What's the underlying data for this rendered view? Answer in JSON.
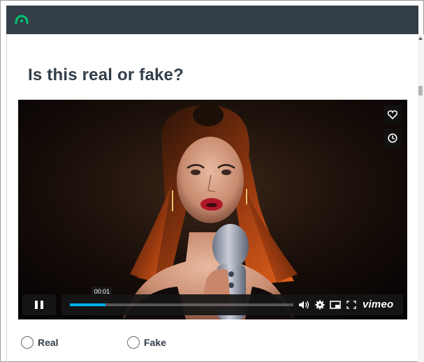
{
  "header": {
    "logo_icon": "surveymonkey-logo-icon",
    "background": "#333e48"
  },
  "question": {
    "title": "Is this real or fake?"
  },
  "video": {
    "progress_percent": 16,
    "time_tooltip": "00:01",
    "brand": "vimeo",
    "overlay_icons": [
      "heart-icon",
      "clock-icon"
    ],
    "control_icons": [
      "pause-icon",
      "volume-icon",
      "gear-icon",
      "pip-icon",
      "fullscreen-icon"
    ],
    "accent": "#00adef"
  },
  "answers": {
    "options": [
      {
        "label": "Real",
        "selected": false
      },
      {
        "label": "Fake",
        "selected": false
      }
    ]
  }
}
